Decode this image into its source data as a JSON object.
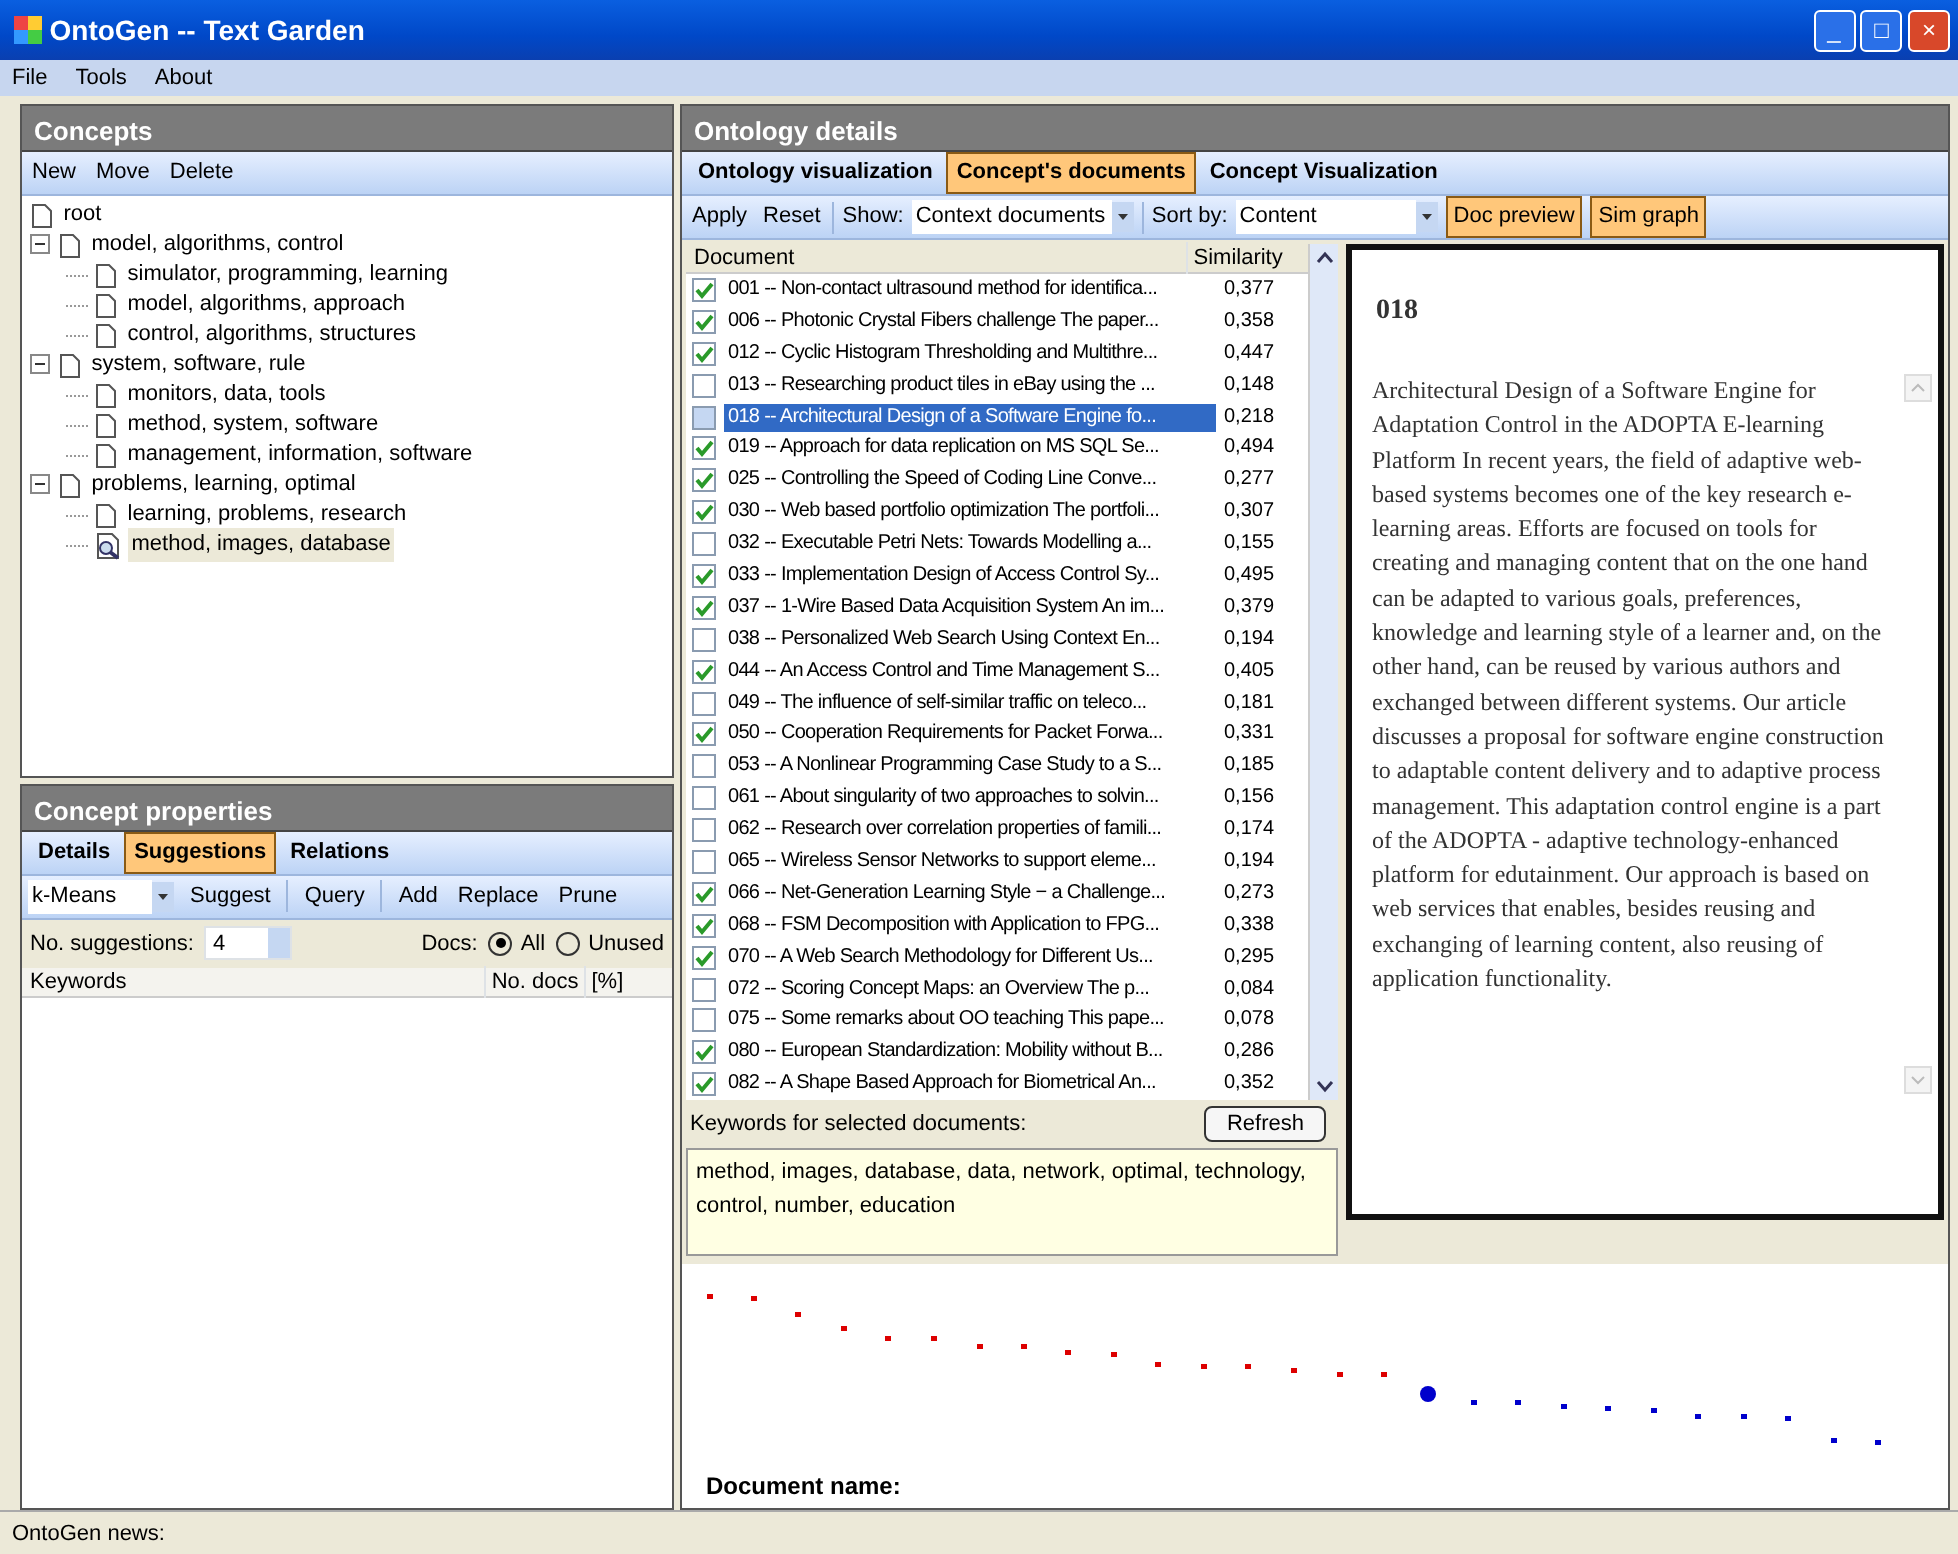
{
  "window": {
    "title": "OntoGen -- Text Garden",
    "controls": [
      "_",
      "□",
      "×"
    ]
  },
  "menu": [
    "File",
    "Tools",
    "About"
  ],
  "concepts": {
    "title": "Concepts",
    "toolbar": [
      "New",
      "Move",
      "Delete"
    ],
    "tree": [
      {
        "label": "root",
        "selected": false
      },
      {
        "label": "model, algorithms, control",
        "selected": false,
        "expanded": true,
        "children": [
          {
            "label": "simulator, programming, learning",
            "selected": false
          },
          {
            "label": "model, algorithms, approach",
            "selected": false
          },
          {
            "label": "control, algorithms, structures",
            "selected": false
          }
        ]
      },
      {
        "label": "system, software, rule",
        "selected": false,
        "expanded": true,
        "children": [
          {
            "label": "monitors, data, tools",
            "selected": false
          },
          {
            "label": "method, system, software",
            "selected": false
          },
          {
            "label": "management, information, software",
            "selected": false
          }
        ]
      },
      {
        "label": "problems, learning, optimal",
        "selected": false,
        "expanded": true,
        "children": [
          {
            "label": "learning, problems, research",
            "selected": false
          },
          {
            "label": "method, images, database",
            "selected": true
          }
        ]
      }
    ]
  },
  "concept_properties": {
    "title": "Concept properties",
    "tabs": [
      {
        "label": "Details",
        "selected": false
      },
      {
        "label": "Suggestions",
        "selected": true
      },
      {
        "label": "Relations",
        "selected": false
      }
    ],
    "method": "k-Means",
    "toolbar": [
      "Suggest",
      "Query",
      "Add",
      "Replace",
      "Prune"
    ],
    "suggestions_label": "No. suggestions:",
    "suggestions_value": "4",
    "docs_label": "Docs:",
    "docs_options": [
      {
        "label": "All",
        "selected": true
      },
      {
        "label": "Unused",
        "selected": false
      }
    ],
    "columns": [
      "Keywords",
      "No. docs",
      "[%]"
    ]
  },
  "ontology_details": {
    "title": "Ontology details",
    "tabs": [
      {
        "label": "Ontology visualization",
        "selected": false
      },
      {
        "label": "Concept's documents",
        "selected": true
      },
      {
        "label": "Concept Visualization",
        "selected": false
      }
    ],
    "toolbar": [
      "Apply",
      "Reset"
    ],
    "show_label": "Show:",
    "show_value": "Context documents",
    "sort_label": "Sort by:",
    "sort_value": "Content",
    "view_buttons": [
      {
        "label": "Doc preview",
        "selected": true
      },
      {
        "label": "Sim graph",
        "selected": true
      }
    ],
    "columns": [
      "Document",
      "Similarity"
    ],
    "documents": [
      {
        "title": "001 -- Non-contact ultrasound method for identifica...",
        "similarity": "0,377",
        "checked": true,
        "selected": false
      },
      {
        "title": "006 -- Photonic Crystal Fibers challenge The paper...",
        "similarity": "0,358",
        "checked": true,
        "selected": false
      },
      {
        "title": "012 -- Cyclic Histogram Thresholding and Multithre...",
        "similarity": "0,447",
        "checked": true,
        "selected": false
      },
      {
        "title": "013 -- Researching product tiles in eBay using the ...",
        "similarity": "0,148",
        "checked": false,
        "selected": false
      },
      {
        "title": "018 -- Architectural Design of a Software Engine fo...",
        "similarity": "0,218",
        "checked": false,
        "selected": true
      },
      {
        "title": "019 -- Approach for data replication on MS SQL Se...",
        "similarity": "0,494",
        "checked": true,
        "selected": false
      },
      {
        "title": "025 -- Controlling the Speed of Coding Line Conve...",
        "similarity": "0,277",
        "checked": true,
        "selected": false
      },
      {
        "title": "030 -- Web based portfolio optimization The portfoli...",
        "similarity": "0,307",
        "checked": true,
        "selected": false
      },
      {
        "title": "032 -- Executable Petri Nets: Towards Modelling a...",
        "similarity": "0,155",
        "checked": false,
        "selected": false
      },
      {
        "title": "033 -- Implementation Design of Access Control Sy...",
        "similarity": "0,495",
        "checked": true,
        "selected": false
      },
      {
        "title": "037 -- 1-Wire Based Data Acquisition System An im...",
        "similarity": "0,379",
        "checked": true,
        "selected": false
      },
      {
        "title": "038 -- Personalized Web Search Using Context En...",
        "similarity": "0,194",
        "checked": false,
        "selected": false
      },
      {
        "title": "044 -- An Access Control and Time Management S...",
        "similarity": "0,405",
        "checked": true,
        "selected": false
      },
      {
        "title": "049 -- The influence of self-similar traffic on teleco...",
        "similarity": "0,181",
        "checked": false,
        "selected": false
      },
      {
        "title": "050 -- Cooperation Requirements for Packet Forwa...",
        "similarity": "0,331",
        "checked": true,
        "selected": false
      },
      {
        "title": "053 -- A Nonlinear Programming Case Study to a S...",
        "similarity": "0,185",
        "checked": false,
        "selected": false
      },
      {
        "title": "061 -- About singularity of two approaches to solvin...",
        "similarity": "0,156",
        "checked": false,
        "selected": false
      },
      {
        "title": "062 -- Research over correlation properties of famili...",
        "similarity": "0,174",
        "checked": false,
        "selected": false
      },
      {
        "title": "065 -- Wireless Sensor Networks to support eleme...",
        "similarity": "0,194",
        "checked": false,
        "selected": false
      },
      {
        "title": "066 -- Net-Generation Learning Style − a Challenge...",
        "similarity": "0,273",
        "checked": true,
        "selected": false
      },
      {
        "title": "068 -- FSM Decomposition with Application to FPG...",
        "similarity": "0,338",
        "checked": true,
        "selected": false
      },
      {
        "title": "070 -- A Web Search Methodology for Different Us...",
        "similarity": "0,295",
        "checked": true,
        "selected": false
      },
      {
        "title": "072 -- Scoring Concept Maps: an Overview  The p...",
        "similarity": "0,084",
        "checked": false,
        "selected": false
      },
      {
        "title": "075 -- Some remarks about OO teaching This pape...",
        "similarity": "0,078",
        "checked": false,
        "selected": false
      },
      {
        "title": "080 -- European Standardization: Mobility without B...",
        "similarity": "0,286",
        "checked": true,
        "selected": false
      },
      {
        "title": "082 -- A Shape Based Approach for Biometrical An...",
        "similarity": "0,352",
        "checked": true,
        "selected": false
      }
    ],
    "keywords_label": "Keywords for selected documents:",
    "refresh": "Refresh",
    "keywords": "method, images, database, data, network, optimal, technology, control, number, education",
    "preview": {
      "heading": "018",
      "text": "Architectural Design of a Software Engine for Adaptation Control in the ADOPTA E-learning Platform In recent years, the field of adaptive web-based systems becomes one of the key research e-learning areas. Efforts are focused on tools for creating and managing content that on the one hand can be adapted to various goals, preferences, knowledge and learning style of a learner and, on the other hand, can be reused by various authors and exchanged between different systems. Our article discusses a proposal for software engine construction to adaptable content delivery and to adaptive process management. This adaptation control engine is a part of the ADOPTA - adaptive technology-enhanced platform for edutainment. Our approach is based on web services that enables, besides reusing and exchanging of learning content, also reusing of application functionality."
    },
    "graph_label": "Document name:"
  },
  "status_bar": "OntoGen news:"
}
